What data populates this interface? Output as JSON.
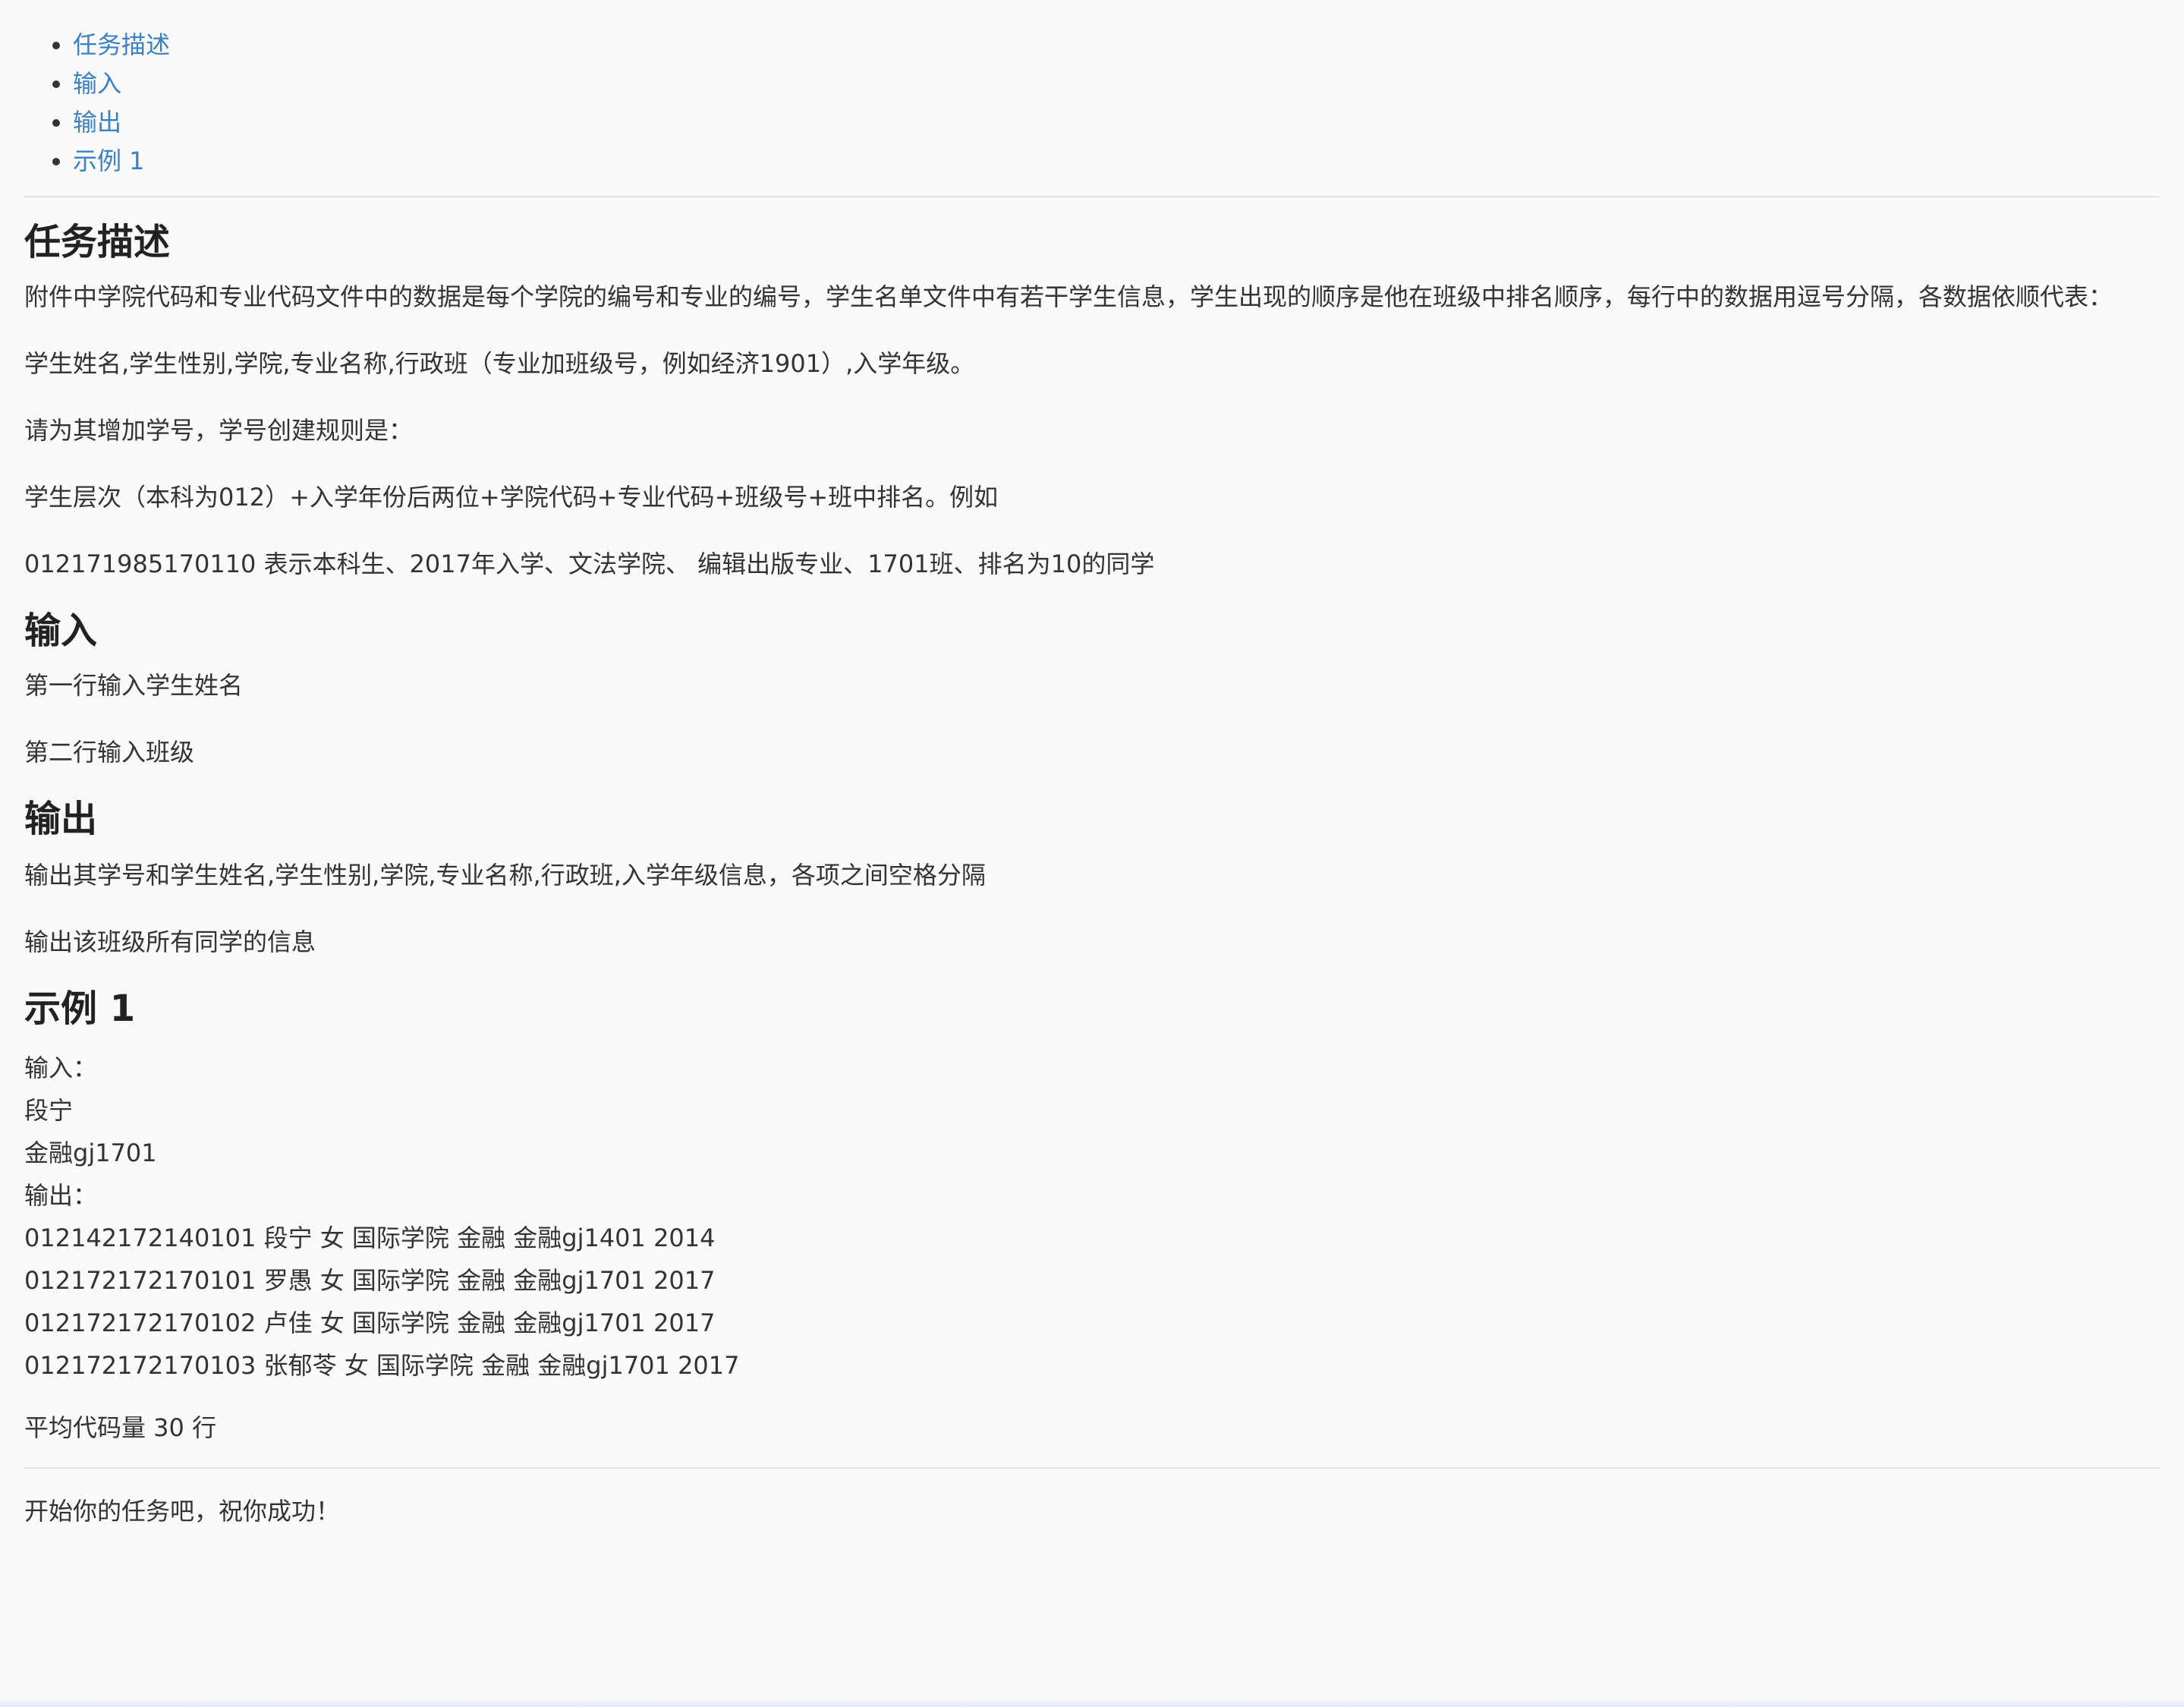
{
  "toc": [
    {
      "label": "任务描述"
    },
    {
      "label": "输入"
    },
    {
      "label": "输出"
    },
    {
      "label": "示例 1"
    }
  ],
  "task": {
    "heading": "任务描述",
    "p1": "附件中学院代码和专业代码文件中的数据是每个学院的编号和专业的编号，学生名单文件中有若干学生信息，学生出现的顺序是他在班级中排名顺序，每行中的数据用逗号分隔，各数据依顺代表：",
    "p2": "学生姓名,学生性别,学院,专业名称,行政班（专业加班级号，例如经济1901）,入学年级。",
    "p3": "请为其增加学号，学号创建规则是：",
    "p4": "学生层次（本科为012）+入学年份后两位+学院代码+专业代码+班级号+班中排名。例如",
    "p5": "012171985170110 表示本科生、2017年入学、文法学院、 编辑出版专业、1701班、排名为10的同学"
  },
  "input": {
    "heading": "输入",
    "p1": "第一行输入学生姓名",
    "p2": "第二行输入班级"
  },
  "output": {
    "heading": "输出",
    "p1": "输出其学号和学生姓名,学生性别,学院,专业名称,行政班,入学年级信息，各项之间空格分隔",
    "p2": "输出该班级所有同学的信息"
  },
  "example": {
    "heading": "示例 1",
    "lines": [
      "输入：",
      "段宁",
      "金融gj1701",
      "输出：",
      "012142172140101 段宁 女 国际学院 金融 金融gj1401 2014",
      "012172172170101 罗愚 女 国际学院 金融 金融gj1701 2017",
      "012172172170102 卢佳 女 国际学院 金融 金融gj1701 2017",
      "012172172170103 张郁苓 女 国际学院 金融 金融gj1701 2017"
    ]
  },
  "avg_code": "平均代码量 30 行",
  "closing": "开始你的任务吧，祝你成功！"
}
